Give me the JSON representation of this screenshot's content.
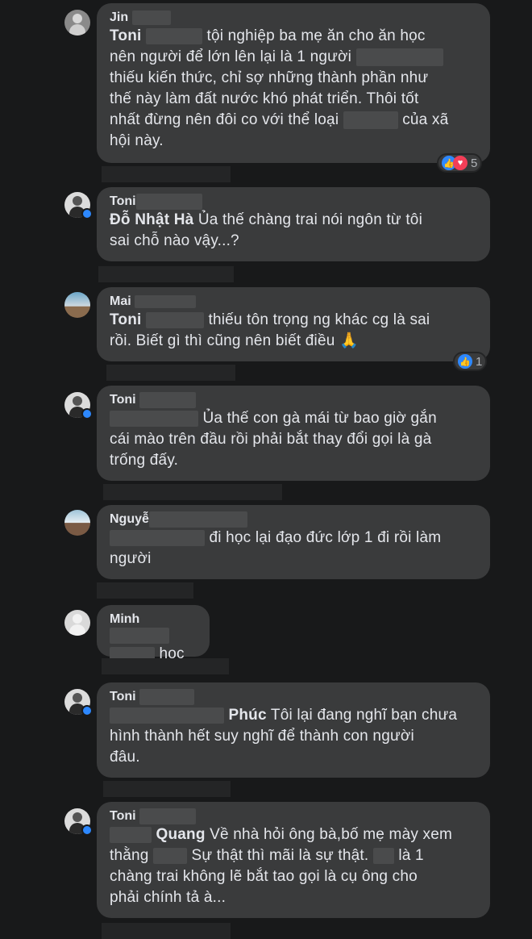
{
  "comments": [
    {
      "author": "Jin",
      "lines": [
        "Toni",
        "tội nghiệp ba mẹ ăn cho ăn học",
        "nên người để lớn lên lại là 1 người",
        "thiếu kiến thức, chỉ sợ những thành phần như",
        "thế này làm đất nước khó phát triển. Thôi tốt",
        "nhất đừng nên đôi co với thể loại",
        "của xã",
        "hội này."
      ],
      "reaction_count": "5"
    },
    {
      "author": "Toni",
      "tag": "Đỗ Nhật Hà",
      "lines": [
        "Ủa thế chàng trai nói ngôn từ tôi",
        "sai chỗ nào vậy...?"
      ]
    },
    {
      "author": "Mai",
      "tag": "Toni",
      "lines": [
        "thiếu tôn trọng ng khác cg là sai",
        "rồi. Biết gì thì cũng nên biết điều",
        "🙏"
      ],
      "reaction_count": "1"
    },
    {
      "author": "Toni",
      "lines": [
        "Ủa thế con gà mái từ bao giờ gắn",
        "cái mào trên đầu rồi phải bắt thay đổi gọi là gà",
        "trống đấy."
      ]
    },
    {
      "author": "Nguyễ",
      "lines": [
        "đi học lại đạo đức lớp 1 đi rồi làm",
        "người"
      ]
    },
    {
      "author": "Minh",
      "lines": [
        "học"
      ]
    },
    {
      "author": "Toni",
      "tag": "Phúc",
      "lines": [
        "Tôi lại đang nghĩ bạn chưa",
        "hình thành hết suy nghĩ để thành con người",
        "đâu."
      ]
    },
    {
      "author": "Toni",
      "tag": "Quang",
      "lines": [
        "Về nhà hỏi ông bà,bố mẹ mày xem",
        "thằng",
        "Sự thật thì mãi là sự thật.",
        "là 1",
        "chàng trai không lẽ bắt tao gọi là cụ ông cho",
        "phải chính tả à..."
      ]
    }
  ],
  "icons": {
    "like": "like-icon",
    "love": "love-icon"
  },
  "colors": {
    "bubble": "#3a3b3c",
    "background": "#18191a",
    "like": "#2d88ff",
    "love": "#f33e58"
  }
}
